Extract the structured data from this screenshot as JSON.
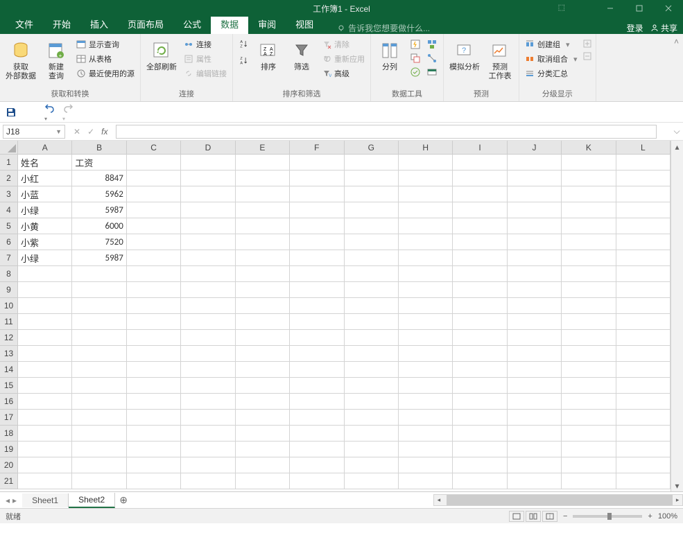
{
  "title": "工作簿1 - Excel",
  "window": {
    "login": "登录",
    "share": "共享"
  },
  "tabs": {
    "file": "文件",
    "home": "开始",
    "insert": "插入",
    "layout": "页面布局",
    "formulas": "公式",
    "data": "数据",
    "review": "审阅",
    "view": "视图"
  },
  "tellme": "告诉我您想要做什么...",
  "ribbon": {
    "g1": {
      "label": "获取和转换",
      "getExternal": "获取\n外部数据",
      "newQuery": "新建\n查询",
      "showQuery": "显示查询",
      "fromTable": "从表格",
      "recentSrc": "最近使用的源"
    },
    "g2": {
      "label": "连接",
      "refreshAll": "全部刷新",
      "connections": "连接",
      "properties": "属性",
      "editLinks": "编辑链接"
    },
    "g3": {
      "label": "排序和筛选",
      "sort": "排序",
      "filter": "筛选",
      "clear": "清除",
      "reapply": "重新应用",
      "advanced": "高级"
    },
    "g4": {
      "label": "数据工具",
      "textToCol": "分列"
    },
    "g5": {
      "label": "预测",
      "whatIf": "模拟分析",
      "forecast": "预测\n工作表"
    },
    "g6": {
      "label": "分级显示",
      "group": "创建组",
      "ungroup": "取消组合",
      "subtotal": "分类汇总"
    }
  },
  "namebox": "J18",
  "columns": [
    "A",
    "B",
    "C",
    "D",
    "E",
    "F",
    "G",
    "H",
    "I",
    "J",
    "K",
    "L"
  ],
  "rowcount": 21,
  "data": {
    "headers": [
      "姓名",
      "工资"
    ],
    "rows": [
      [
        "小红",
        "8847"
      ],
      [
        "小蓝",
        "5962"
      ],
      [
        "小绿",
        "5987"
      ],
      [
        "小黄",
        "6000"
      ],
      [
        "小紫",
        "7520"
      ],
      [
        "小绿",
        "5987"
      ]
    ]
  },
  "sheets": {
    "s1": "Sheet1",
    "s2": "Sheet2"
  },
  "status": {
    "ready": "就绪",
    "zoom": "100%"
  }
}
